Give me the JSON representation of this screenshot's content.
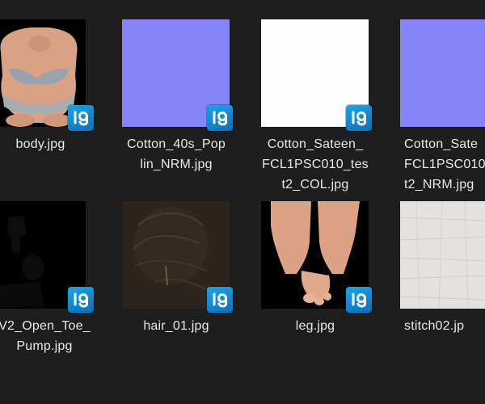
{
  "files": [
    {
      "name": "body.jpg",
      "type": "texture",
      "preview": "body-texture"
    },
    {
      "name": "Cotton_40s_Pop\nlin_NRM.jpg",
      "type": "normal-map",
      "preview_color": "#8684fa"
    },
    {
      "name": "Cotton_Sateen_\nFCL1PSC010_tes\nt2_COL.jpg",
      "type": "color-map",
      "preview_color": "#fefefe"
    },
    {
      "name": "Cotton_Sate\nFCL1PSC010\nt2_NRM.jpg",
      "type": "normal-map",
      "preview_color": "#8684fa"
    },
    {
      "name": "V2_Open_Toe_\nPump.jpg",
      "type": "texture",
      "preview": "shoe-texture"
    },
    {
      "name": "hair_01.jpg",
      "type": "texture",
      "preview": "hair-texture"
    },
    {
      "name": "leg.jpg",
      "type": "texture",
      "preview": "leg-texture"
    },
    {
      "name": "stitch02.jp",
      "type": "texture",
      "preview": "stitch-texture"
    }
  ],
  "badge": {
    "icon": "app-file-badge-icon",
    "color": "#1aa5e6"
  }
}
